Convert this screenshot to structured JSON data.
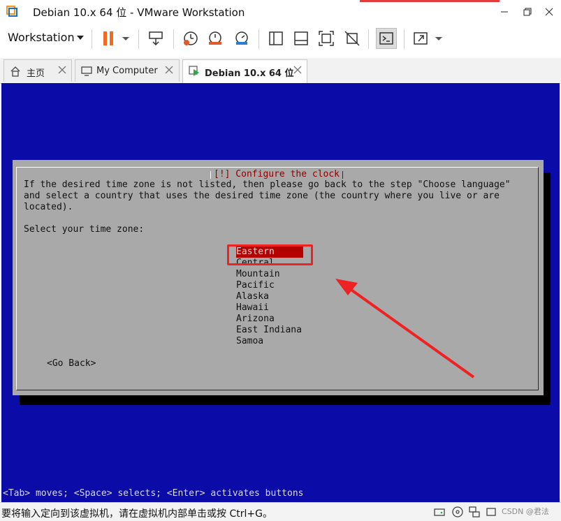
{
  "window": {
    "title": "Debian 10.x 64 位 - VMware Workstation",
    "menu_label": "Workstation"
  },
  "toolbar": {
    "icons": [
      "pause-icon",
      "send-ctrl-alt-del-icon",
      "snapshot-icon",
      "revert-snapshot-icon",
      "snapshot-manager-icon",
      "sidebar-toggle-icon",
      "console-view-icon",
      "fullscreen-icon",
      "unity-icon",
      "terminal-icon",
      "stretch-icon"
    ]
  },
  "tabs": [
    {
      "label": "主页",
      "icon": "home-icon"
    },
    {
      "label": "My Computer",
      "icon": "computer-icon"
    },
    {
      "label": "Debian 10.x 64 位",
      "icon": "vm-icon",
      "active": true
    }
  ],
  "installer": {
    "dialog_title": "[!] Configure the clock",
    "instructions": "If the desired time zone is not listed, then please go back to the step \"Choose language\"\nand select a country that uses the desired time zone (the country where you live or are\nlocated).",
    "prompt": "Select your time zone:",
    "timezones": [
      "Eastern",
      "Central",
      "Mountain",
      "Pacific",
      "Alaska",
      "Hawaii",
      "Arizona",
      "East Indiana",
      "Samoa"
    ],
    "selected": "Eastern",
    "go_back": "<Go Back>",
    "hint": "<Tab> moves; <Space> selects; <Enter> activates buttons"
  },
  "statusbar": {
    "text": "要将输入定向到该虚拟机，请在虚拟机内部单击或按 Ctrl+G。",
    "watermark": "CSDN @君法"
  },
  "colors": {
    "console_bg": "#0b0ba8",
    "dialog_bg": "#a9a9a9",
    "title_red": "#8c0000",
    "selection_bg": "#b30000",
    "annotation_red": "#ee2222",
    "pause_orange": "#f26b21"
  }
}
